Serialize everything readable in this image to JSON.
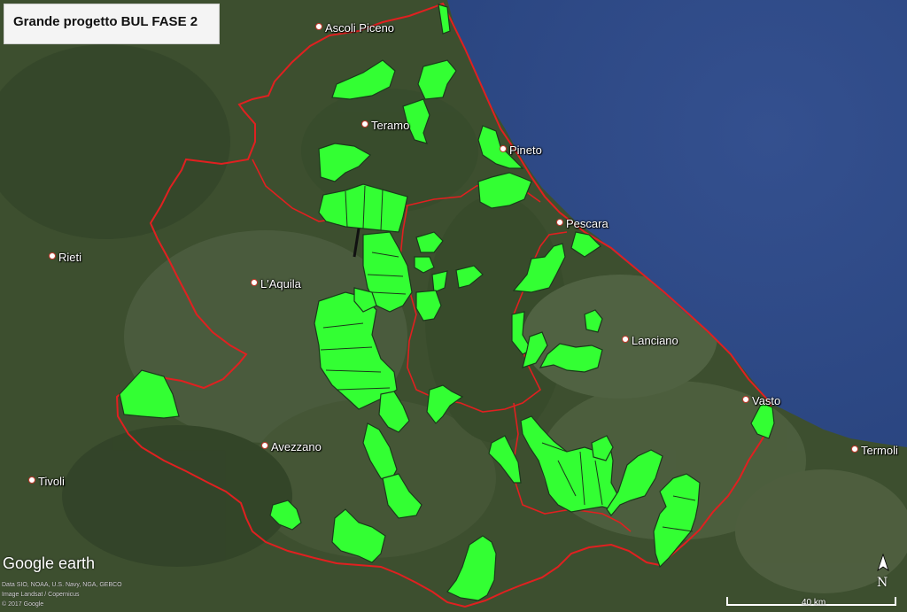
{
  "title": "Grande progetto BUL FASE 2",
  "places": [
    {
      "id": "ascoli-piceno",
      "label": "Ascoli Piceno"
    },
    {
      "id": "teramo",
      "label": "Teramo"
    },
    {
      "id": "pineto",
      "label": "Pineto"
    },
    {
      "id": "pescara",
      "label": "Pescara"
    },
    {
      "id": "rieti",
      "label": "Rieti"
    },
    {
      "id": "laquila",
      "label": "L'Aquila"
    },
    {
      "id": "lanciano",
      "label": "Lanciano"
    },
    {
      "id": "vasto",
      "label": "Vasto"
    },
    {
      "id": "termoli",
      "label": "Termoli"
    },
    {
      "id": "avezzano",
      "label": "Avezzano"
    },
    {
      "id": "tivoli",
      "label": "Tivoli"
    }
  ],
  "logo": "Google earth",
  "credits": {
    "line1": "Data SIO, NOAA, U.S. Navy, NGA, GEBCO",
    "line2": "Image Landsat / Copernicus",
    "line3": "© 2017 Google"
  },
  "north_label": "N",
  "scale_label": "40 km",
  "colors": {
    "sea": "#2f4a8a",
    "land": "#3f5231",
    "boundary": "#e02020",
    "project_area": "#33ff33"
  }
}
